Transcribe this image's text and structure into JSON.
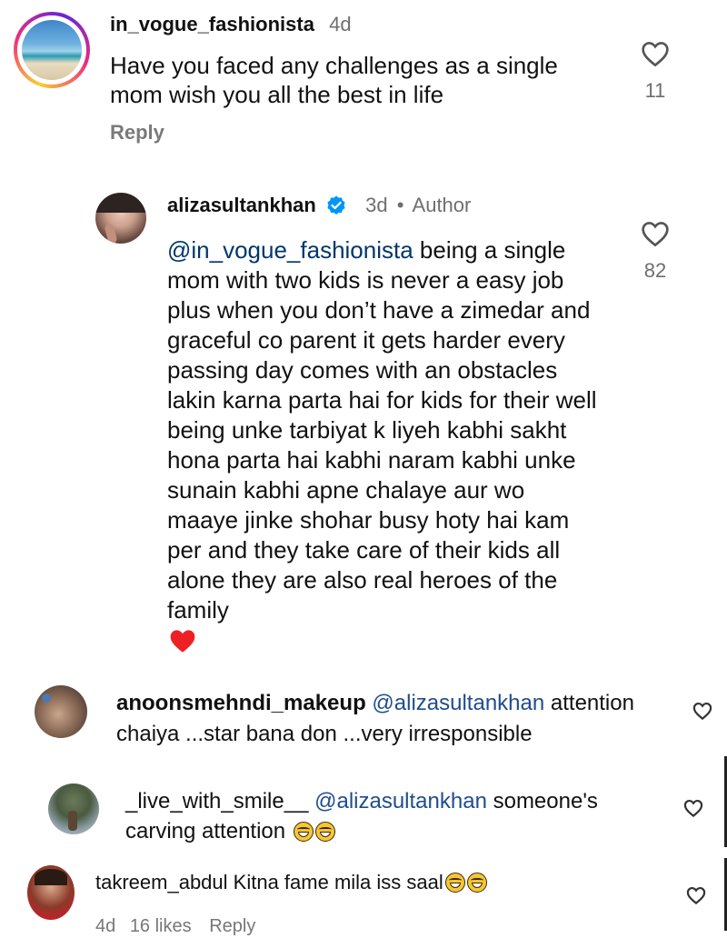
{
  "comments": [
    {
      "username": "in_vogue_fashionista",
      "time": "4d",
      "text": "Have you faced any challenges as a single mom wish you all the best in life",
      "likes": "11",
      "reply_label": "Reply"
    },
    {
      "username": "alizasultankhan",
      "time": "3d",
      "separator": "•",
      "author_label": "Author",
      "mention": "@in_vogue_fashionista",
      "text": " being a single mom with two kids is never a easy job plus when you don’t have a zimedar and graceful co parent it gets harder every passing day comes with an obstacles lakin karna parta hai for kids for their well being unke tarbiyat k liyeh kabhi sakht hona parta hai kabhi naram kabhi unke sunain kabhi apne chalaye aur wo maaye jinke shohar busy hoty hai kam per and they take care of their kids all alone they are also real heroes of the family",
      "likes": "82"
    },
    {
      "username": "anoonsmehndi_makeup",
      "mention": "@alizasultankhan",
      "text_after": " attention",
      "text_line2": "chaiya ...star bana don ...very irresponsible"
    },
    {
      "username": "_live_with_smile__",
      "mention": "@alizasultankhan",
      "text_after": " someone's",
      "text_line2": "carving attention"
    },
    {
      "username": "takreem_abdul",
      "text": " Kitna fame mila iss saal",
      "time": "4d",
      "likes_text": "16 likes",
      "reply_label": "Reply"
    }
  ],
  "colors": {
    "verified": "#0095f6",
    "heart_red": "#ed2024",
    "meta_gray": "#6e6e6e",
    "mention_blue": "#00376b"
  },
  "icons": {
    "like": "heart-outline-icon",
    "verified": "verified-badge-icon",
    "reaction": "red-heart-emoji",
    "laugh": "tears-of-joy-emoji"
  }
}
